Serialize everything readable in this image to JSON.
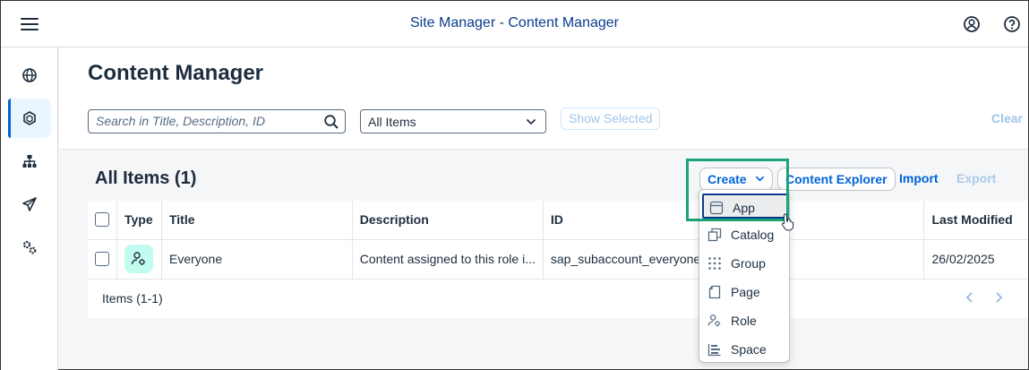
{
  "shell": {
    "title": "Site Manager - Content Manager",
    "icons": [
      "menu-icon",
      "user-icon",
      "help-icon"
    ]
  },
  "sidenav": {
    "items": [
      {
        "name": "globe-icon",
        "active": false
      },
      {
        "name": "content-cube-icon",
        "active": true
      },
      {
        "name": "hierarchy-icon",
        "active": false
      },
      {
        "name": "paper-plane-icon",
        "active": false
      },
      {
        "name": "settings-gears-icon",
        "active": false
      }
    ]
  },
  "page": {
    "title": "Content Manager",
    "search_placeholder": "Search in Title, Description, ID",
    "filter_value": "All Items",
    "show_selected": "Show Selected",
    "clear": "Clear"
  },
  "table": {
    "title": "All Items (1)",
    "toolbar": {
      "create": "Create",
      "content_explorer": "Content Explorer",
      "import": "Import",
      "export": "Export"
    },
    "columns": [
      "Type",
      "Title",
      "Description",
      "ID",
      "Last Modified"
    ],
    "rows": [
      {
        "type_icon": "role-icon",
        "title": "Everyone",
        "description": "Content assigned to this role i...",
        "id": "sap_subaccount_everyone",
        "last_modified": "26/02/2025"
      }
    ],
    "footer": "Items (1-1)"
  },
  "create_menu": {
    "items": [
      {
        "label": "App",
        "icon": "app-icon"
      },
      {
        "label": "Catalog",
        "icon": "catalog-icon"
      },
      {
        "label": "Group",
        "icon": "group-grid-icon"
      },
      {
        "label": "Page",
        "icon": "page-icon"
      },
      {
        "label": "Role",
        "icon": "role-icon"
      },
      {
        "label": "Space",
        "icon": "space-icon"
      }
    ]
  },
  "colors": {
    "accent": "#0064d9",
    "shell_title": "#0a3c8c",
    "highlight": "#1aa37a",
    "role_icon_bg": "#c2fcee"
  }
}
